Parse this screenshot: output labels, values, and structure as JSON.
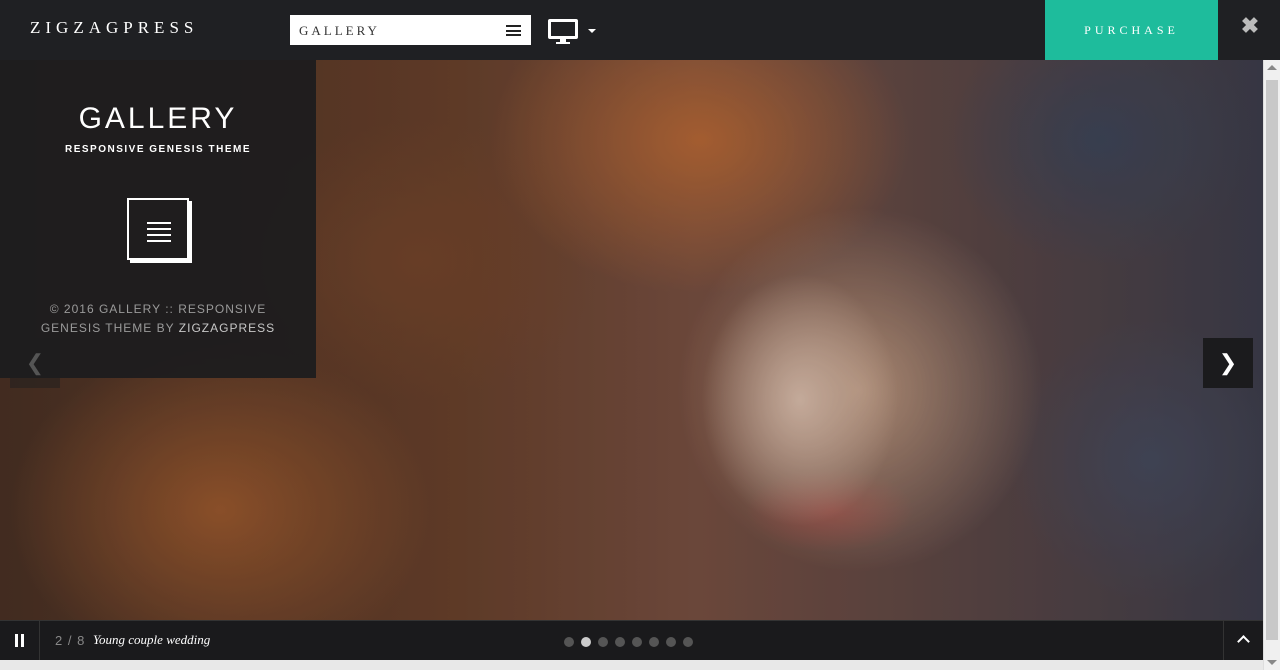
{
  "topbar": {
    "brand": "ZIGZAGPRESS",
    "theme_select": {
      "value": "GALLERY",
      "icon": "hamburger-icon"
    },
    "device_toggle": {
      "icon": "desktop-icon",
      "caret": "caret-down-icon"
    },
    "purchase_label": "PURCHASE",
    "close_icon": "close-icon",
    "accent_color": "#1ebc9c"
  },
  "panel": {
    "title": "GALLERY",
    "subtitle": "RESPONSIVE GENESIS THEME",
    "menu_icon": "hamburger-icon",
    "copyright_line1": "© 2016 GALLERY :: RESPONSIVE",
    "copyright_line2_prefix": "GENESIS THEME BY ",
    "copyright_line2_link": "ZIGZAGPRESS"
  },
  "slider": {
    "prev_icon": "chevron-left-icon",
    "next_icon": "chevron-right-icon",
    "counter": "2 / 8",
    "caption": "Young couple wedding",
    "total_slides": 8,
    "active_slide": 2
  },
  "bottombar": {
    "pause_icon": "pause-icon",
    "up_icon": "chevron-up-icon"
  }
}
